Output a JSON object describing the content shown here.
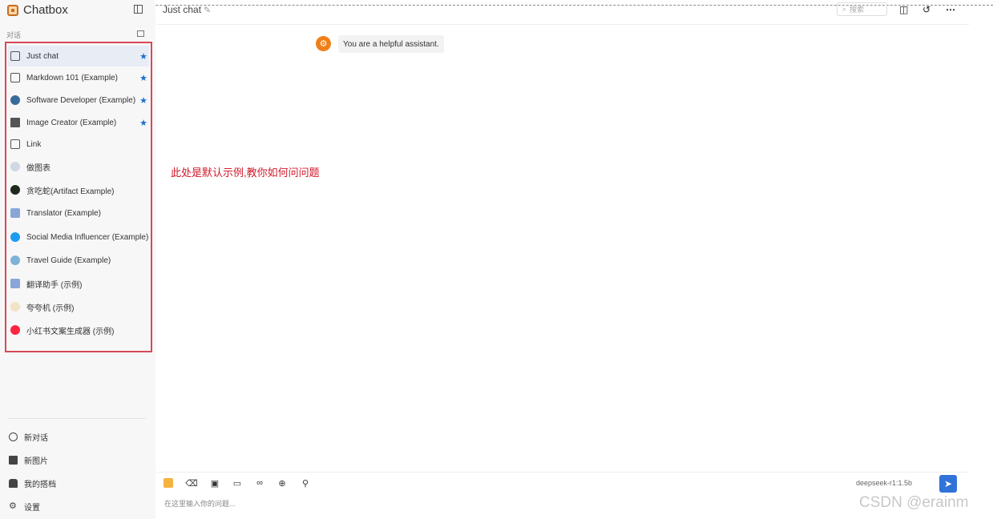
{
  "app": {
    "title": "Chatbox"
  },
  "sidebar": {
    "section_label": "对话",
    "sessions": [
      {
        "label": "Just chat",
        "starred": true,
        "active": true,
        "icon": "chat-bubble-icon"
      },
      {
        "label": "Markdown 101 (Example)",
        "starred": true,
        "icon": "chat-bubble-icon"
      },
      {
        "label": "Software Developer (Example)",
        "starred": true,
        "icon": "developer-avatar-icon"
      },
      {
        "label": "Image Creator (Example)",
        "starred": true,
        "icon": "image-icon"
      },
      {
        "label": "Link",
        "starred": false,
        "icon": "chat-bubble-icon"
      },
      {
        "label": "做图表",
        "starred": false,
        "icon": "chart-avatar-icon"
      },
      {
        "label": "贪吃蛇(Artifact Example)",
        "starred": false,
        "icon": "snake-avatar-icon"
      },
      {
        "label": "Translator (Example)",
        "starred": false,
        "icon": "translator-avatar-icon"
      },
      {
        "label": "Social Media Influencer (Example)",
        "starred": false,
        "icon": "twitter-avatar-icon"
      },
      {
        "label": "Travel Guide (Example)",
        "starred": false,
        "icon": "globe-avatar-icon"
      },
      {
        "label": "翻译助手 (示例)",
        "starred": false,
        "icon": "translator-avatar-icon"
      },
      {
        "label": "夸夸机 (示例)",
        "starred": false,
        "icon": "praise-avatar-icon"
      },
      {
        "label": "小红书文案生成器 (示例)",
        "starred": false,
        "icon": "xiaohongshu-avatar-icon"
      }
    ],
    "footer": [
      {
        "label": "新对话",
        "icon": "plus-circle-icon"
      },
      {
        "label": "新图片",
        "icon": "new-image-icon"
      },
      {
        "label": "我的搭档",
        "icon": "partner-icon"
      },
      {
        "label": "设置",
        "icon": "gear-icon"
      }
    ]
  },
  "header": {
    "chat_title": "Just chat",
    "search_placeholder": "搜索"
  },
  "messages": {
    "system_text": "You are a helpful assistant."
  },
  "annotation": "此处是默认示例,教你如何问问题",
  "input": {
    "placeholder": "在这里输入你的问题...",
    "model": "deepseek-r1:1.5b"
  },
  "watermark": "CSDN @erainm",
  "colors": {
    "accent": "#2f73d9",
    "annotation": "#d1182b",
    "highlight_border": "#d64a55",
    "system_avatar": "#f07f19"
  }
}
